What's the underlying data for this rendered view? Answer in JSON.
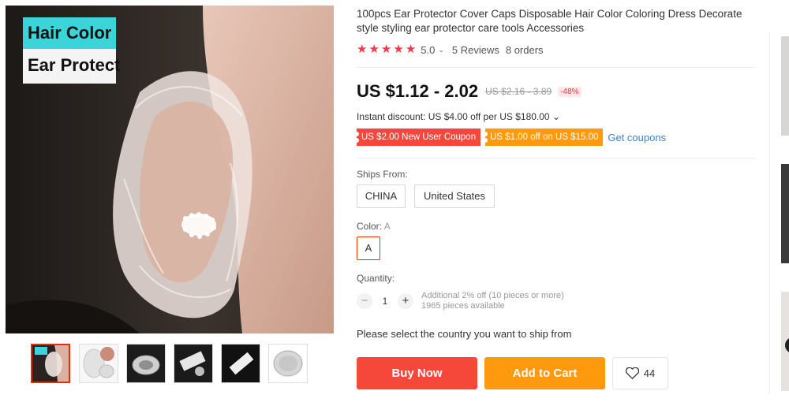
{
  "gallery": {
    "overlay_line1": "Hair Color",
    "overlay_line2": "Ear Protect",
    "thumbnails": [
      "thumb-1",
      "thumb-2",
      "thumb-3",
      "thumb-4",
      "thumb-5",
      "thumb-6"
    ],
    "active_index": 0
  },
  "product": {
    "title": "100pcs Ear Protector Cover Caps Disposable Hair Color Coloring Dress Decorate style styling ear protector care tools Accessories",
    "rating": {
      "stars": 5,
      "score": "5.0",
      "caret": "⌄",
      "reviews": "5 Reviews",
      "orders": "8 orders"
    },
    "price": "US $1.12 - 2.02",
    "old_price": "US $2.16 - 3.89",
    "discount": "-48%",
    "instant_discount": "Instant discount: US $4.00 off per US $180.00 ⌄",
    "coupons": [
      {
        "label": "US $2.00 New User Coupon",
        "color": "#f5483b"
      },
      {
        "label": "US $1.00 off on US $15.00",
        "color": "#ff9a0e"
      }
    ],
    "get_coupons": "Get coupons"
  },
  "options": {
    "ships_from_label": "Ships From:",
    "ships_from": [
      "CHINA",
      "United States"
    ],
    "color_label": "Color:",
    "color_selected": "A",
    "colors": [
      "A"
    ],
    "quantity_label": "Quantity:",
    "quantity": "1",
    "minus": "−",
    "plus": "+",
    "additional_off": "Additional 2% off (10 pieces or more)",
    "available": "1965 pieces available"
  },
  "actions": {
    "ship_note": "Please select the country you want to ship from",
    "buy_now": "Buy Now",
    "add_to_cart": "Add to Cart",
    "wishlist_count": "44"
  },
  "colors": {
    "accent_red": "#f5483b",
    "accent_orange": "#ff9a0e",
    "link_blue": "#3b82c4",
    "star": "#f0394a"
  }
}
